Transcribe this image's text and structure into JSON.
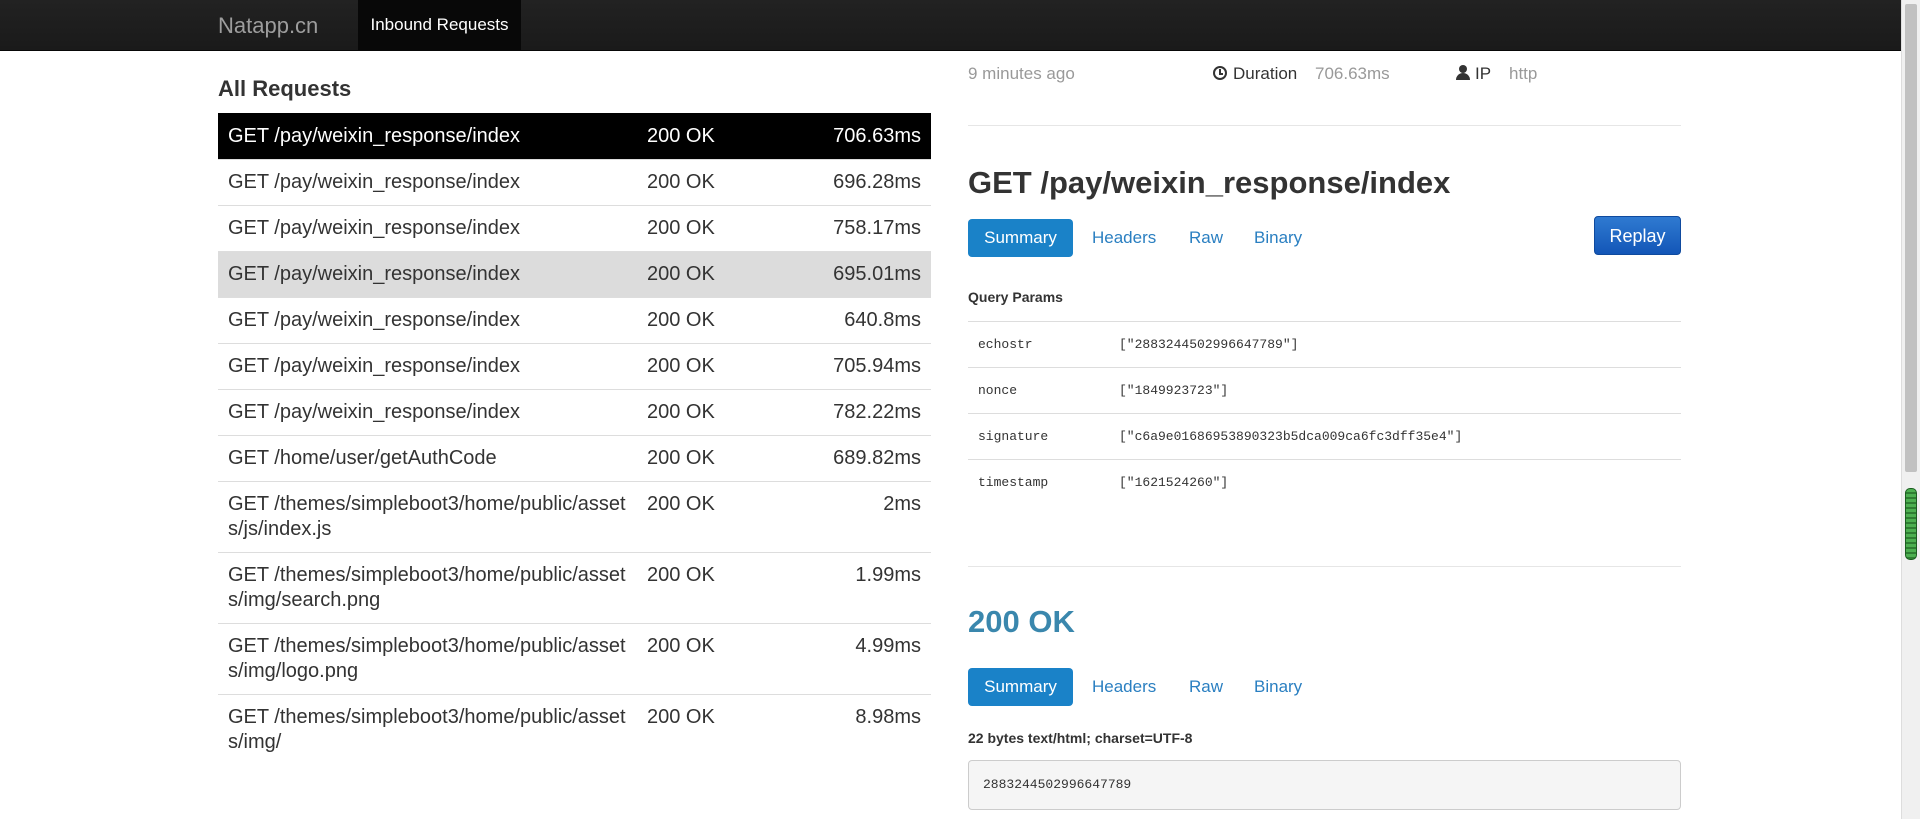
{
  "navbar": {
    "brand": "Natapp.cn",
    "active_tab": "Inbound Requests"
  },
  "requests": {
    "title": "All Requests",
    "rows": [
      {
        "path": "GET /pay/weixin_response/index",
        "status": "200 OK",
        "duration": "706.63ms",
        "state": "active"
      },
      {
        "path": "GET /pay/weixin_response/index",
        "status": "200 OK",
        "duration": "696.28ms",
        "state": ""
      },
      {
        "path": "GET /pay/weixin_response/index",
        "status": "200 OK",
        "duration": "758.17ms",
        "state": ""
      },
      {
        "path": "GET /pay/weixin_response/index",
        "status": "200 OK",
        "duration": "695.01ms",
        "state": "hover"
      },
      {
        "path": "GET /pay/weixin_response/index",
        "status": "200 OK",
        "duration": "640.8ms",
        "state": ""
      },
      {
        "path": "GET /pay/weixin_response/index",
        "status": "200 OK",
        "duration": "705.94ms",
        "state": ""
      },
      {
        "path": "GET /pay/weixin_response/index",
        "status": "200 OK",
        "duration": "782.22ms",
        "state": ""
      },
      {
        "path": "GET /home/user/getAuthCode",
        "status": "200 OK",
        "duration": "689.82ms",
        "state": ""
      },
      {
        "path": "GET /themes/simpleboot3/home/public/assets/js/index.js",
        "status": "200 OK",
        "duration": "2ms",
        "state": ""
      },
      {
        "path": "GET /themes/simpleboot3/home/public/assets/img/search.png",
        "status": "200 OK",
        "duration": "1.99ms",
        "state": ""
      },
      {
        "path": "GET /themes/simpleboot3/home/public/assets/img/logo.png",
        "status": "200 OK",
        "duration": "4.99ms",
        "state": ""
      },
      {
        "path": "GET /themes/simpleboot3/home/public/assets/img/",
        "status": "200 OK",
        "duration": "8.98ms",
        "state": ""
      }
    ]
  },
  "detail": {
    "time_ago": "9 minutes ago",
    "duration_label": "Duration",
    "duration_value": "706.63ms",
    "ip_label": "IP",
    "ip_value": "http",
    "request_title": "GET /pay/weixin_response/index",
    "tabs": [
      "Summary",
      "Headers",
      "Raw",
      "Binary"
    ],
    "replay_label": "Replay",
    "query_params_label": "Query Params",
    "query_params": [
      {
        "key": "echostr",
        "value": "[\"2883244502996647789\"]"
      },
      {
        "key": "nonce",
        "value": "[\"1849923723\"]"
      },
      {
        "key": "signature",
        "value": "[\"c6a9e01686953890323b5dca009ca6fc3dff35e4\"]"
      },
      {
        "key": "timestamp",
        "value": "[\"1621524260\"]"
      }
    ],
    "response_status": "200 OK",
    "response_tabs": [
      "Summary",
      "Headers",
      "Raw",
      "Binary"
    ],
    "response_meta": "22 bytes text/html; charset=UTF-8",
    "response_body": "2883244502996647789"
  }
}
